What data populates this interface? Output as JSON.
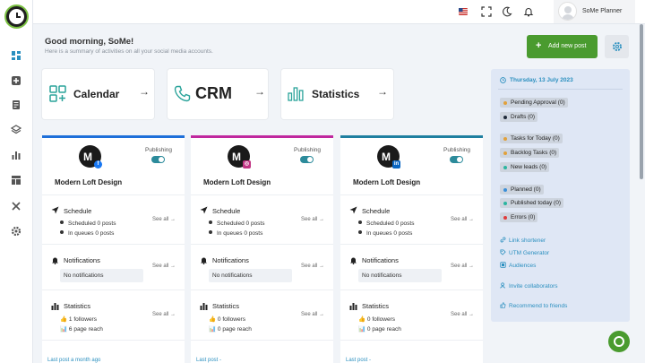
{
  "colors": {
    "brand_green": "#4a9b2f",
    "accent_blue": "#2a8fbf",
    "facebook": "#1877f2",
    "instagram": "#c13584",
    "linkedin": "#0a66c2",
    "col1_line": "#1e6fd9",
    "col2_line": "#c0289e",
    "col3_line": "#1f7fa0"
  },
  "sidebar": {
    "icons": [
      "dashboard-icon",
      "add-icon",
      "document-icon",
      "layers-icon",
      "bar-chart-icon",
      "layout-icon",
      "tools-icon",
      "gear-icon"
    ]
  },
  "topbar": {
    "user_name": "SoMe Planner"
  },
  "greeting": {
    "title": "Good morning, SoMe!",
    "subtitle": "Here is a summary of activities on all your social media accounts."
  },
  "actions": {
    "add_post": "Add new post"
  },
  "quick_links": [
    {
      "label": "Calendar"
    },
    {
      "label": "CRM"
    },
    {
      "label": "Statistics"
    }
  ],
  "panel": {
    "date": "Thursday, 13 July 2023",
    "chips": [
      {
        "label": "Pending Approval (0)",
        "color": "#e2a13a"
      },
      {
        "label": "Drafts (0)",
        "color": "#1f2a3a"
      },
      {
        "label": "Tasks for Today (0)",
        "color": "#e2a13a"
      },
      {
        "label": "Backlog Tasks (0)",
        "color": "#e2a13a"
      },
      {
        "label": "New leads (0)",
        "color": "#2bb5a0"
      },
      {
        "label": "Planned (0)",
        "color": "#3b8fd9"
      },
      {
        "label": "Published today (0)",
        "color": "#2bb5a0"
      },
      {
        "label": "Errors (0)",
        "color": "#e03b3b"
      }
    ],
    "links": [
      {
        "label": "Link shortener"
      },
      {
        "label": "UTM Generator"
      },
      {
        "label": "Audiences"
      },
      {
        "label": "Invite collaborators"
      },
      {
        "label": "Recommend to friends"
      }
    ]
  },
  "accounts": [
    {
      "name": "Modern Loft Design",
      "network_icon": "facebook-icon",
      "publishing_label": "Publishing",
      "schedule_title": "Schedule",
      "scheduled": "Scheduled 0 posts",
      "in_queues": "In queues 0 posts",
      "notifications_title": "Notifications",
      "notifications_empty": "No notifications",
      "statistics_title": "Statistics",
      "followers": "1 followers",
      "page_reach": "6 page reach",
      "see_all": "See all →",
      "last_post": "Last post a month ago"
    },
    {
      "name": "Modern Loft Design",
      "network_icon": "instagram-icon",
      "publishing_label": "Publishing",
      "schedule_title": "Schedule",
      "scheduled": "Scheduled 0 posts",
      "in_queues": "In queues 0 posts",
      "notifications_title": "Notifications",
      "notifications_empty": "No notifications",
      "statistics_title": "Statistics",
      "followers": "0 followers",
      "page_reach": "0 page reach",
      "see_all": "See all →",
      "last_post": "Last post -"
    },
    {
      "name": "Modern Loft Design",
      "network_icon": "linkedin-icon",
      "publishing_label": "Publishing",
      "schedule_title": "Schedule",
      "scheduled": "Scheduled 0 posts",
      "in_queues": "In queues 0 posts",
      "notifications_title": "Notifications",
      "notifications_empty": "No notifications",
      "statistics_title": "Statistics",
      "followers": "0 followers",
      "page_reach": "0 page reach",
      "see_all": "See all →",
      "last_post": "Last post -"
    }
  ]
}
